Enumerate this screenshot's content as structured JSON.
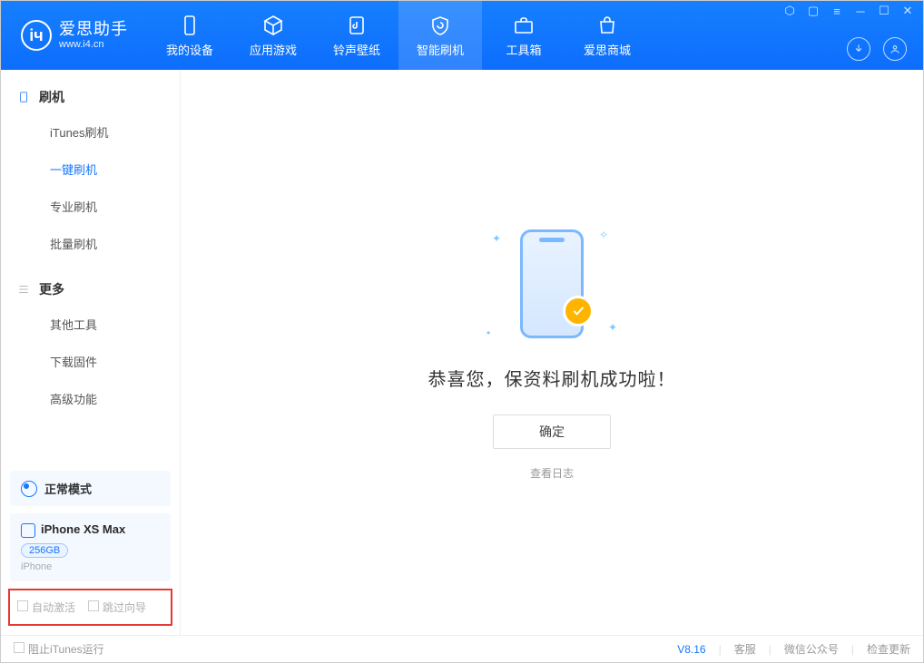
{
  "app": {
    "title": "爱思助手",
    "url": "www.i4.cn"
  },
  "tabs": {
    "device": "我的设备",
    "apps": "应用游戏",
    "ringtone": "铃声壁纸",
    "flash": "智能刷机",
    "toolbox": "工具箱",
    "store": "爱思商城"
  },
  "sidebar": {
    "flash_title": "刷机",
    "items": {
      "itunes": "iTunes刷机",
      "oneclick": "一键刷机",
      "pro": "专业刷机",
      "batch": "批量刷机"
    },
    "more_title": "更多",
    "more": {
      "other_tools": "其他工具",
      "download_fw": "下载固件",
      "advanced": "高级功能"
    }
  },
  "device": {
    "mode": "正常模式",
    "name": "iPhone XS Max",
    "storage": "256GB",
    "type": "iPhone"
  },
  "options": {
    "auto_activate": "自动激活",
    "skip_guide": "跳过向导"
  },
  "result": {
    "message": "恭喜您，保资料刷机成功啦！",
    "ok": "确定",
    "view_log": "查看日志"
  },
  "footer": {
    "block_itunes": "阻止iTunes运行",
    "version": "V8.16",
    "support": "客服",
    "wechat": "微信公众号",
    "update": "检查更新"
  }
}
